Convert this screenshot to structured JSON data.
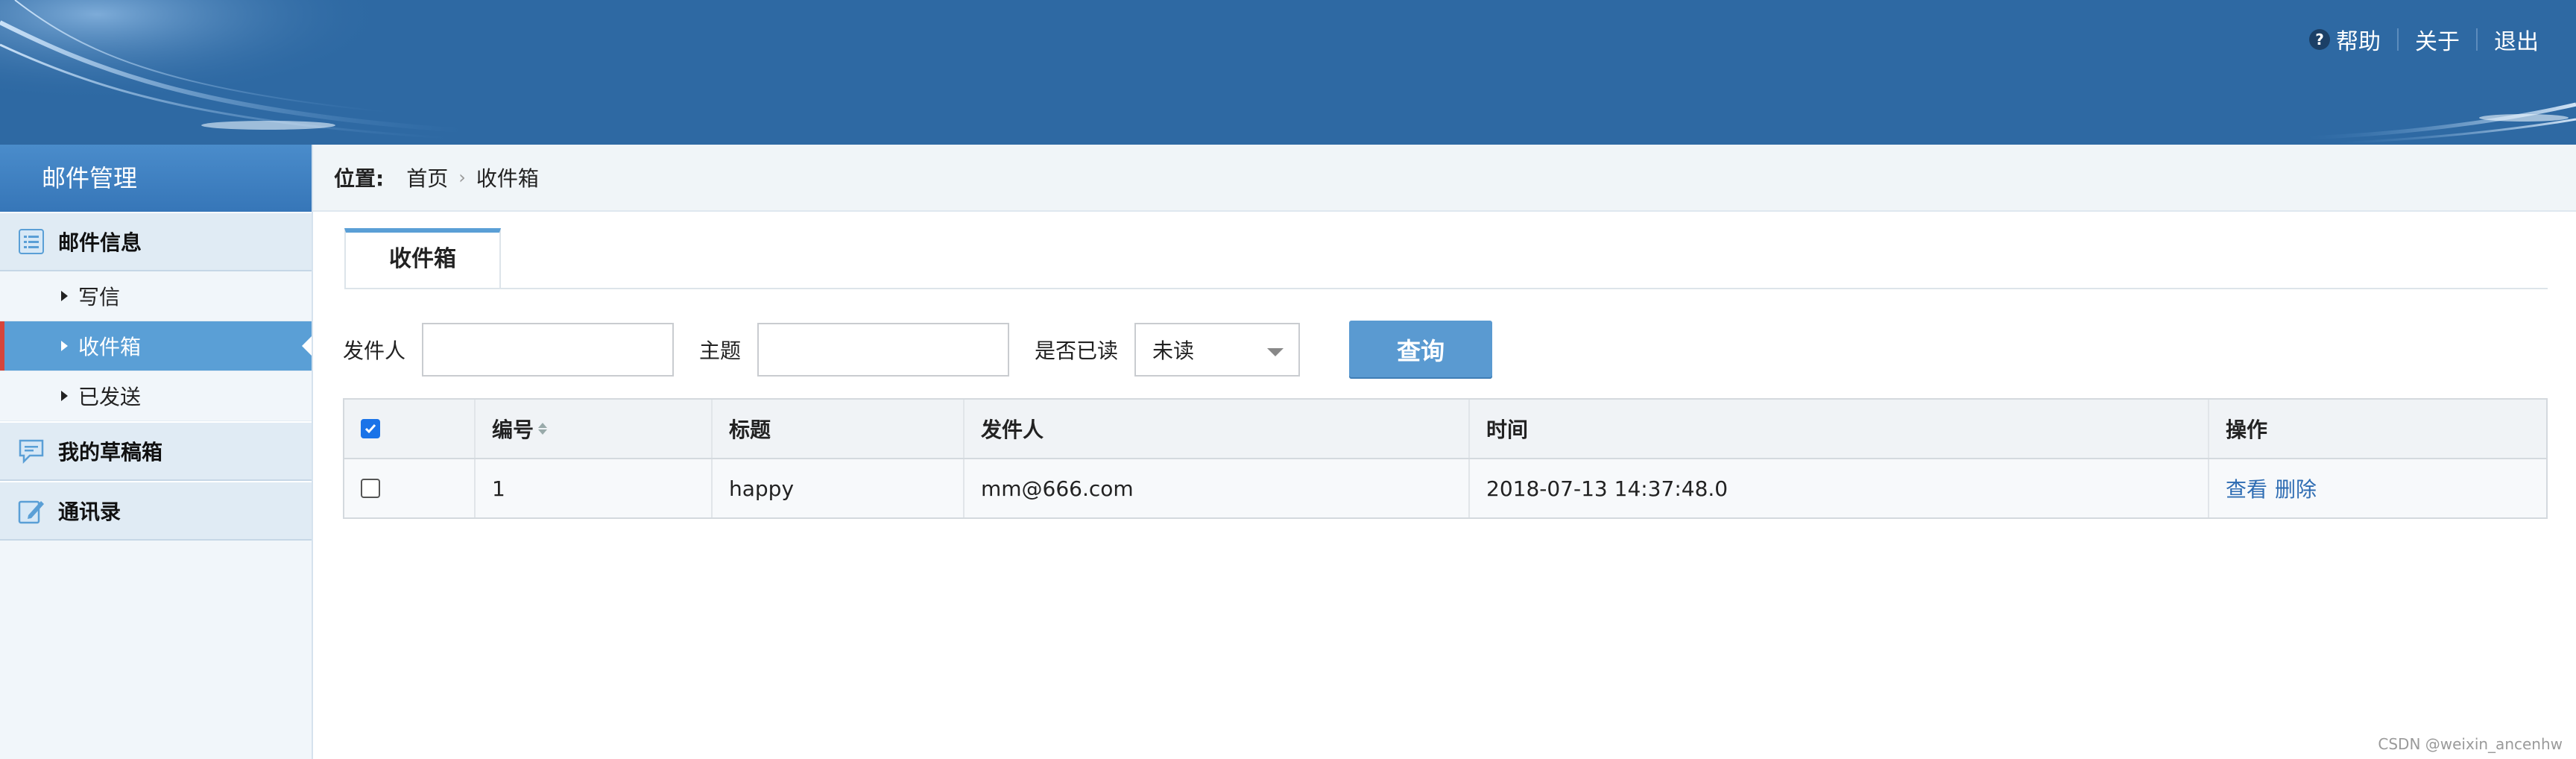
{
  "header": {
    "links": {
      "help": "帮助",
      "about": "关于",
      "logout": "退出"
    }
  },
  "sidebar": {
    "title": "邮件管理",
    "groups": [
      {
        "label": "邮件信息",
        "icon": "list-icon",
        "items": [
          {
            "label": "写信"
          },
          {
            "label": "收件箱",
            "active": true
          },
          {
            "label": "已发送"
          }
        ]
      },
      {
        "label": "我的草稿箱",
        "icon": "chat-icon"
      },
      {
        "label": "通讯录",
        "icon": "edit-icon"
      }
    ]
  },
  "breadcrumb": {
    "prefix": "位置:",
    "items": [
      "首页",
      "收件箱"
    ]
  },
  "tab": {
    "label": "收件箱"
  },
  "filter": {
    "sender_label": "发件人",
    "sender_value": "",
    "subject_label": "主题",
    "subject_value": "",
    "read_label": "是否已读",
    "read_selected": "未读",
    "query_button": "查询"
  },
  "table": {
    "columns": [
      "编号",
      "标题",
      "发件人",
      "时间",
      "操作"
    ],
    "header_checked": true,
    "rows": [
      {
        "checked": false,
        "id": "1",
        "title": "happy",
        "sender": "mm@666.com",
        "time": "2018-07-13 14:37:48.0",
        "actions": [
          "查看",
          "删除"
        ]
      }
    ]
  },
  "watermark": "CSDN @weixin_ancenhw",
  "colors": {
    "header": "#2e69a3",
    "sidebar_title": "#3d7fc1",
    "active_item": "#5a9fd6",
    "active_marker": "#d6453b",
    "query_button": "#5a9ad1",
    "link": "#2f6db3"
  }
}
